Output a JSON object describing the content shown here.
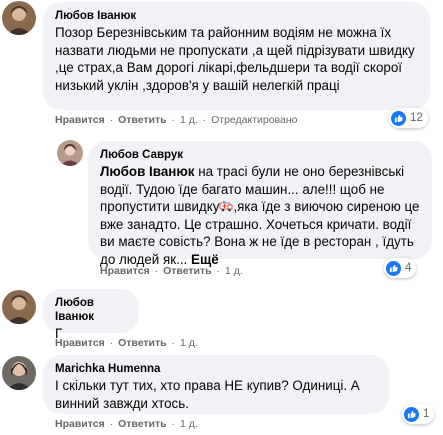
{
  "comments": [
    {
      "author": "Любов Іванюк",
      "text": "Позор Березнівським та районним водіям не можна їх назвати людьми не пропускати ,а щей підрізувати швидку ,це страх,а Вам дорогі лікарі,фельдшери та водії скорої низький уклін ,здоров'я у вашій нелегкій праці",
      "actions": {
        "like": "Нравится",
        "reply": "Ответить",
        "time": "1 д.",
        "edited": "Отредактировано"
      },
      "reactions": {
        "icon": "like-icon",
        "count": "12"
      }
    },
    {
      "author": "Любов Саврук",
      "mention": "Любов Іванюк",
      "text_part1": " на трасі були не оно березнівські водії. Тудою їде багато машин... але!!! щоб не пропустити швидку",
      "emoji": "ambulance-emoji",
      "text_part2": ",яка їде з виючою сиреною це вже занадто. Це страшно. Хочеться кричати. водії ви маєте совість? Вона ж не їде в ресторан , їдуть до людей як...",
      "more": "Ещё",
      "actions": {
        "like": "Нравится",
        "reply": "Ответить",
        "time": "1 д."
      },
      "reactions": {
        "icon": "like-icon",
        "count": "4"
      }
    },
    {
      "author": "Любов Іванюк",
      "text": "Г",
      "actions": {
        "like": "Нравится",
        "reply": "Ответить",
        "time": "1 д."
      }
    },
    {
      "author": "Marichka Humenna",
      "text": "І скільки тут тих, хто права НЕ купив? Одиниці. А винний завжди хтось.",
      "actions": {
        "like": "Нравится",
        "reply": "Ответить",
        "time": "1 д."
      },
      "reactions": {
        "icon": "like-icon",
        "count": "1"
      }
    }
  ],
  "separator": "·",
  "colors": {
    "bubble": "#f0f2f5",
    "meta": "#65676b",
    "like": "#1877f2"
  }
}
